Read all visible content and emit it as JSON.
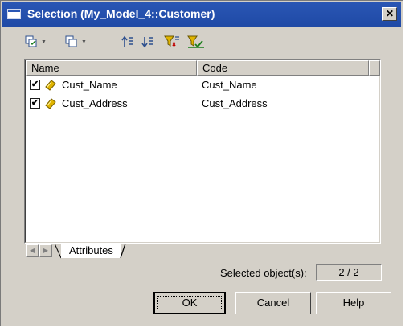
{
  "window": {
    "title": "Selection (My_Model_4::Customer)",
    "close_glyph": "✕"
  },
  "toolbar": {
    "items": [
      {
        "icon": "select-all-icon",
        "dropdown": true
      },
      {
        "icon": "deselect-all-icon",
        "dropdown": true
      },
      {
        "icon": "move-to-top-icon",
        "dropdown": false
      },
      {
        "icon": "move-to-bottom-icon",
        "dropdown": false
      },
      {
        "icon": "filter-icon",
        "dropdown": false
      },
      {
        "icon": "filter-selected-icon",
        "dropdown": false
      }
    ],
    "caret_glyph": "▼"
  },
  "list": {
    "columns": [
      "Name",
      "Code"
    ],
    "rows": [
      {
        "checked": true,
        "check_glyph": "✔",
        "icon": "attribute-icon",
        "name": "Cust_Name",
        "code": "Cust_Name"
      },
      {
        "checked": true,
        "check_glyph": "✔",
        "icon": "attribute-icon",
        "name": "Cust_Address",
        "code": "Cust_Address"
      }
    ]
  },
  "tabs": {
    "scroll_left": "◀",
    "scroll_right": "▶",
    "active": "Attributes"
  },
  "selection": {
    "label": "Selected object(s):",
    "value": "2 / 2"
  },
  "buttons": {
    "ok": "OK",
    "cancel": "Cancel",
    "help": "Help"
  },
  "colors": {
    "dialog_bg": "#d4d0c8",
    "title_bar": "#1f4aa6",
    "attribute_icon": "#e0b400"
  }
}
